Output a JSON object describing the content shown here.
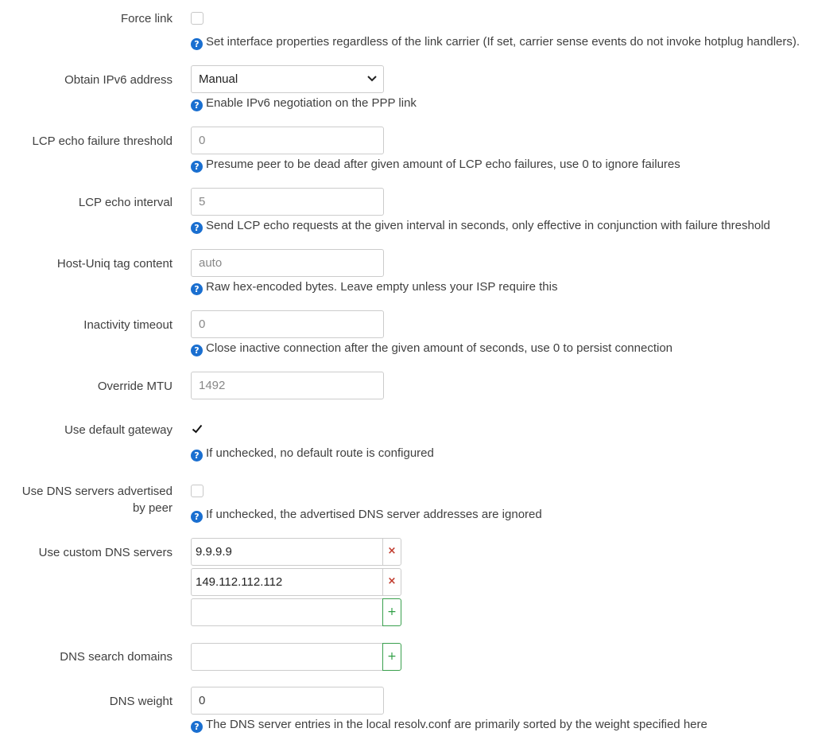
{
  "fields": {
    "force_link": {
      "label": "Force link",
      "checked": false,
      "help": "Set interface properties regardless of the link carrier (If set, carrier sense events do not invoke hotplug handlers)."
    },
    "obtain_ipv6": {
      "label": "Obtain IPv6 address",
      "selected": "Manual",
      "help": "Enable IPv6 negotiation on the PPP link"
    },
    "lcp_failure": {
      "label": "LCP echo failure threshold",
      "placeholder": "0",
      "help": "Presume peer to be dead after given amount of LCP echo failures, use 0 to ignore failures"
    },
    "lcp_interval": {
      "label": "LCP echo interval",
      "placeholder": "5",
      "help": "Send LCP echo requests at the given interval in seconds, only effective in conjunction with failure threshold"
    },
    "host_uniq": {
      "label": "Host-Uniq tag content",
      "placeholder": "auto",
      "help": "Raw hex-encoded bytes. Leave empty unless your ISP require this"
    },
    "inactivity": {
      "label": "Inactivity timeout",
      "placeholder": "0",
      "help": "Close inactive connection after the given amount of seconds, use 0 to persist connection"
    },
    "mtu": {
      "label": "Override MTU",
      "placeholder": "1492"
    },
    "default_gw": {
      "label": "Use default gateway",
      "checked": true,
      "help": "If unchecked, no default route is configured"
    },
    "peer_dns": {
      "label_line1": "Use DNS servers advertised",
      "label_line2": "by peer",
      "checked": false,
      "help": "If unchecked, the advertised DNS server addresses are ignored"
    },
    "custom_dns": {
      "label": "Use custom DNS servers",
      "entries": [
        "9.9.9.9",
        "149.112.112.112"
      ],
      "remove_symbol": "×",
      "add_symbol": "+"
    },
    "dns_search": {
      "label": "DNS search domains",
      "add_symbol": "+"
    },
    "dns_weight": {
      "label": "DNS weight",
      "value": "0",
      "help": "The DNS server entries in the local resolv.conf are primarily sorted by the weight specified here"
    }
  },
  "help_icon": "?",
  "colors": {
    "help_icon": "#1a6fd0",
    "remove": "#c0392b",
    "add": "#2e9e44"
  }
}
